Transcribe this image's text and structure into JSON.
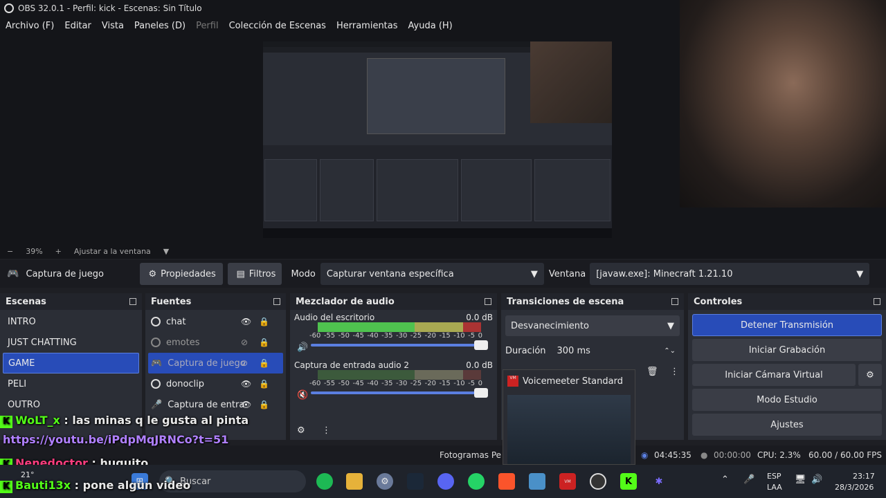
{
  "title": "OBS 32.0.1 - Perfil: kick - Escenas: Sin Título",
  "menu": [
    "Archivo (F)",
    "Editar",
    "Vista",
    "Paneles (D)",
    "Perfil",
    "Colección de Escenas",
    "Herramientas",
    "Ayuda (H)"
  ],
  "zoom": {
    "minus": "−",
    "value": "39%",
    "plus": "+",
    "fit": "Ajustar a la ventana"
  },
  "source_bar": {
    "source_name": "Captura de juego",
    "properties": "Propiedades",
    "filters": "Filtros",
    "mode_label": "Modo",
    "mode_value": "Capturar ventana específica",
    "window_label": "Ventana",
    "window_value": "[javaw.exe]: Minecraft 1.21.10"
  },
  "scenes": {
    "title": "Escenas",
    "items": [
      "INTRO",
      "JUST CHATTING",
      "GAME",
      "PELI",
      "OUTRO"
    ]
  },
  "sources": {
    "title": "Fuentes",
    "items": [
      "chat",
      "emotes",
      "Captura de juego",
      "donoclip",
      "Captura de entra"
    ]
  },
  "mixer": {
    "title": "Mezclador de audio",
    "channels": [
      {
        "name": "Audio del escritorio",
        "db": "0.0 dB"
      },
      {
        "name": "Captura de entrada audio 2",
        "db": "0.0 dB"
      }
    ],
    "ticks": [
      "-60",
      "-55",
      "-50",
      "-45",
      "-40",
      "-35",
      "-30",
      "-25",
      "-20",
      "-15",
      "-10",
      "-5",
      "0"
    ]
  },
  "transitions": {
    "title": "Transiciones de escena",
    "type": "Desvanecimiento",
    "duration_label": "Duración",
    "duration_value": "300 ms"
  },
  "controls": {
    "title": "Controles",
    "stop_stream": "Detener Transmisión",
    "start_recording": "Iniciar Grabación",
    "virtual_cam": "Iniciar Cámara Virtual",
    "studio_mode": "Modo Estudio",
    "settings": "Ajustes"
  },
  "chat": [
    {
      "user": "WoLT_x",
      "msg": "las minas q le gusta al pinta",
      "color": "#53fc18"
    },
    {
      "user": "",
      "msg": "https://youtu.be/iPdpMqJRNCo?t=51",
      "color": "#b080ff"
    },
    {
      "user": "Nenedoctor",
      "msg": "huguito",
      "color": "#ff3d7f"
    },
    {
      "user": "Bauti13x",
      "msg": "pone algun video",
      "color": "#53fc18"
    }
  ],
  "status": {
    "frames": "Fotogramas Pe",
    "stream_time": "04:45:35",
    "rec_time": "00:00:00",
    "cpu": "CPU: 2.3%",
    "fps": "60.00 / 60.00 FPS"
  },
  "voicemeeter": {
    "title": "Voicemeeter Standard"
  },
  "taskbar": {
    "temp": "21°",
    "search": "Buscar",
    "lang1": "ESP",
    "lang2": "LAA",
    "time": "23:17",
    "date": "28/3/2026"
  },
  "colors": {
    "accent": "#284cb8",
    "kick": "#53fc18"
  }
}
